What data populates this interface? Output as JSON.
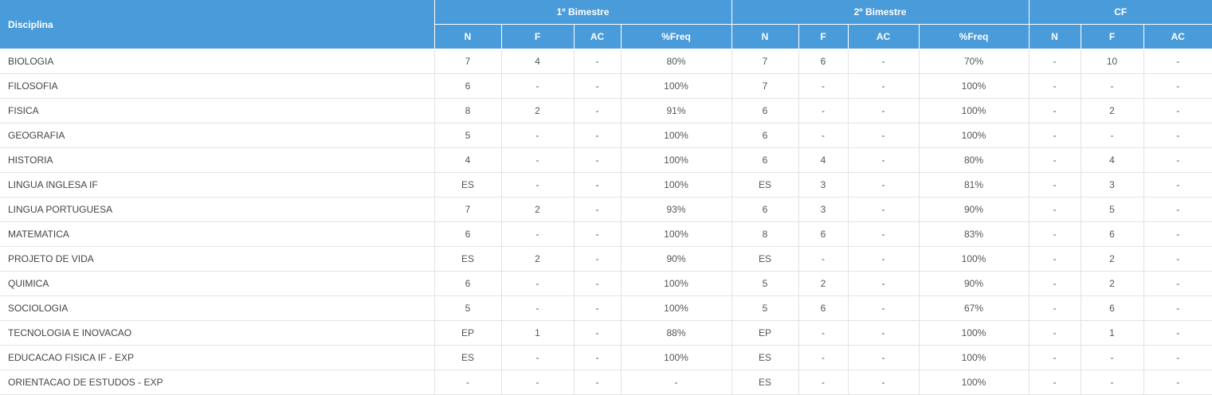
{
  "header": {
    "discipline_label": "Disciplina",
    "groups": [
      "1º Bimestre",
      "2º Bimestre",
      "CF"
    ],
    "sub": {
      "b1": [
        "N",
        "F",
        "AC",
        "%Freq"
      ],
      "b2": [
        "N",
        "F",
        "AC",
        "%Freq"
      ],
      "cf": [
        "N",
        "F",
        "AC"
      ]
    }
  },
  "rows": [
    {
      "disciplina": "BIOLOGIA",
      "b1": [
        "7",
        "4",
        "-",
        "80%"
      ],
      "b2": [
        "7",
        "6",
        "-",
        "70%"
      ],
      "cf": [
        "-",
        "10",
        "-"
      ]
    },
    {
      "disciplina": "FILOSOFIA",
      "b1": [
        "6",
        "-",
        "-",
        "100%"
      ],
      "b2": [
        "7",
        "-",
        "-",
        "100%"
      ],
      "cf": [
        "-",
        "-",
        "-"
      ]
    },
    {
      "disciplina": "FISICA",
      "b1": [
        "8",
        "2",
        "-",
        "91%"
      ],
      "b2": [
        "6",
        "-",
        "-",
        "100%"
      ],
      "cf": [
        "-",
        "2",
        "-"
      ]
    },
    {
      "disciplina": "GEOGRAFIA",
      "b1": [
        "5",
        "-",
        "-",
        "100%"
      ],
      "b2": [
        "6",
        "-",
        "-",
        "100%"
      ],
      "cf": [
        "-",
        "-",
        "-"
      ]
    },
    {
      "disciplina": "HISTORIA",
      "b1": [
        "4",
        "-",
        "-",
        "100%"
      ],
      "b2": [
        "6",
        "4",
        "-",
        "80%"
      ],
      "cf": [
        "-",
        "4",
        "-"
      ]
    },
    {
      "disciplina": "LINGUA INGLESA IF",
      "b1": [
        "ES",
        "-",
        "-",
        "100%"
      ],
      "b2": [
        "ES",
        "3",
        "-",
        "81%"
      ],
      "cf": [
        "-",
        "3",
        "-"
      ]
    },
    {
      "disciplina": "LINGUA PORTUGUESA",
      "b1": [
        "7",
        "2",
        "-",
        "93%"
      ],
      "b2": [
        "6",
        "3",
        "-",
        "90%"
      ],
      "cf": [
        "-",
        "5",
        "-"
      ]
    },
    {
      "disciplina": "MATEMATICA",
      "b1": [
        "6",
        "-",
        "-",
        "100%"
      ],
      "b2": [
        "8",
        "6",
        "-",
        "83%"
      ],
      "cf": [
        "-",
        "6",
        "-"
      ]
    },
    {
      "disciplina": "PROJETO DE VIDA",
      "b1": [
        "ES",
        "2",
        "-",
        "90%"
      ],
      "b2": [
        "ES",
        "-",
        "-",
        "100%"
      ],
      "cf": [
        "-",
        "2",
        "-"
      ]
    },
    {
      "disciplina": "QUIMICA",
      "b1": [
        "6",
        "-",
        "-",
        "100%"
      ],
      "b2": [
        "5",
        "2",
        "-",
        "90%"
      ],
      "cf": [
        "-",
        "2",
        "-"
      ]
    },
    {
      "disciplina": "SOCIOLOGIA",
      "b1": [
        "5",
        "-",
        "-",
        "100%"
      ],
      "b2": [
        "5",
        "6",
        "-",
        "67%"
      ],
      "cf": [
        "-",
        "6",
        "-"
      ]
    },
    {
      "disciplina": "TECNOLOGIA E INOVACAO",
      "b1": [
        "EP",
        "1",
        "-",
        "88%"
      ],
      "b2": [
        "EP",
        "-",
        "-",
        "100%"
      ],
      "cf": [
        "-",
        "1",
        "-"
      ]
    },
    {
      "disciplina": "EDUCACAO FISICA IF - EXP",
      "b1": [
        "ES",
        "-",
        "-",
        "100%"
      ],
      "b2": [
        "ES",
        "-",
        "-",
        "100%"
      ],
      "cf": [
        "-",
        "-",
        "-"
      ]
    },
    {
      "disciplina": "ORIENTACAO DE ESTUDOS - EXP",
      "b1": [
        "-",
        "-",
        "-",
        "-"
      ],
      "b2": [
        "ES",
        "-",
        "-",
        "100%"
      ],
      "cf": [
        "-",
        "-",
        "-"
      ]
    }
  ]
}
